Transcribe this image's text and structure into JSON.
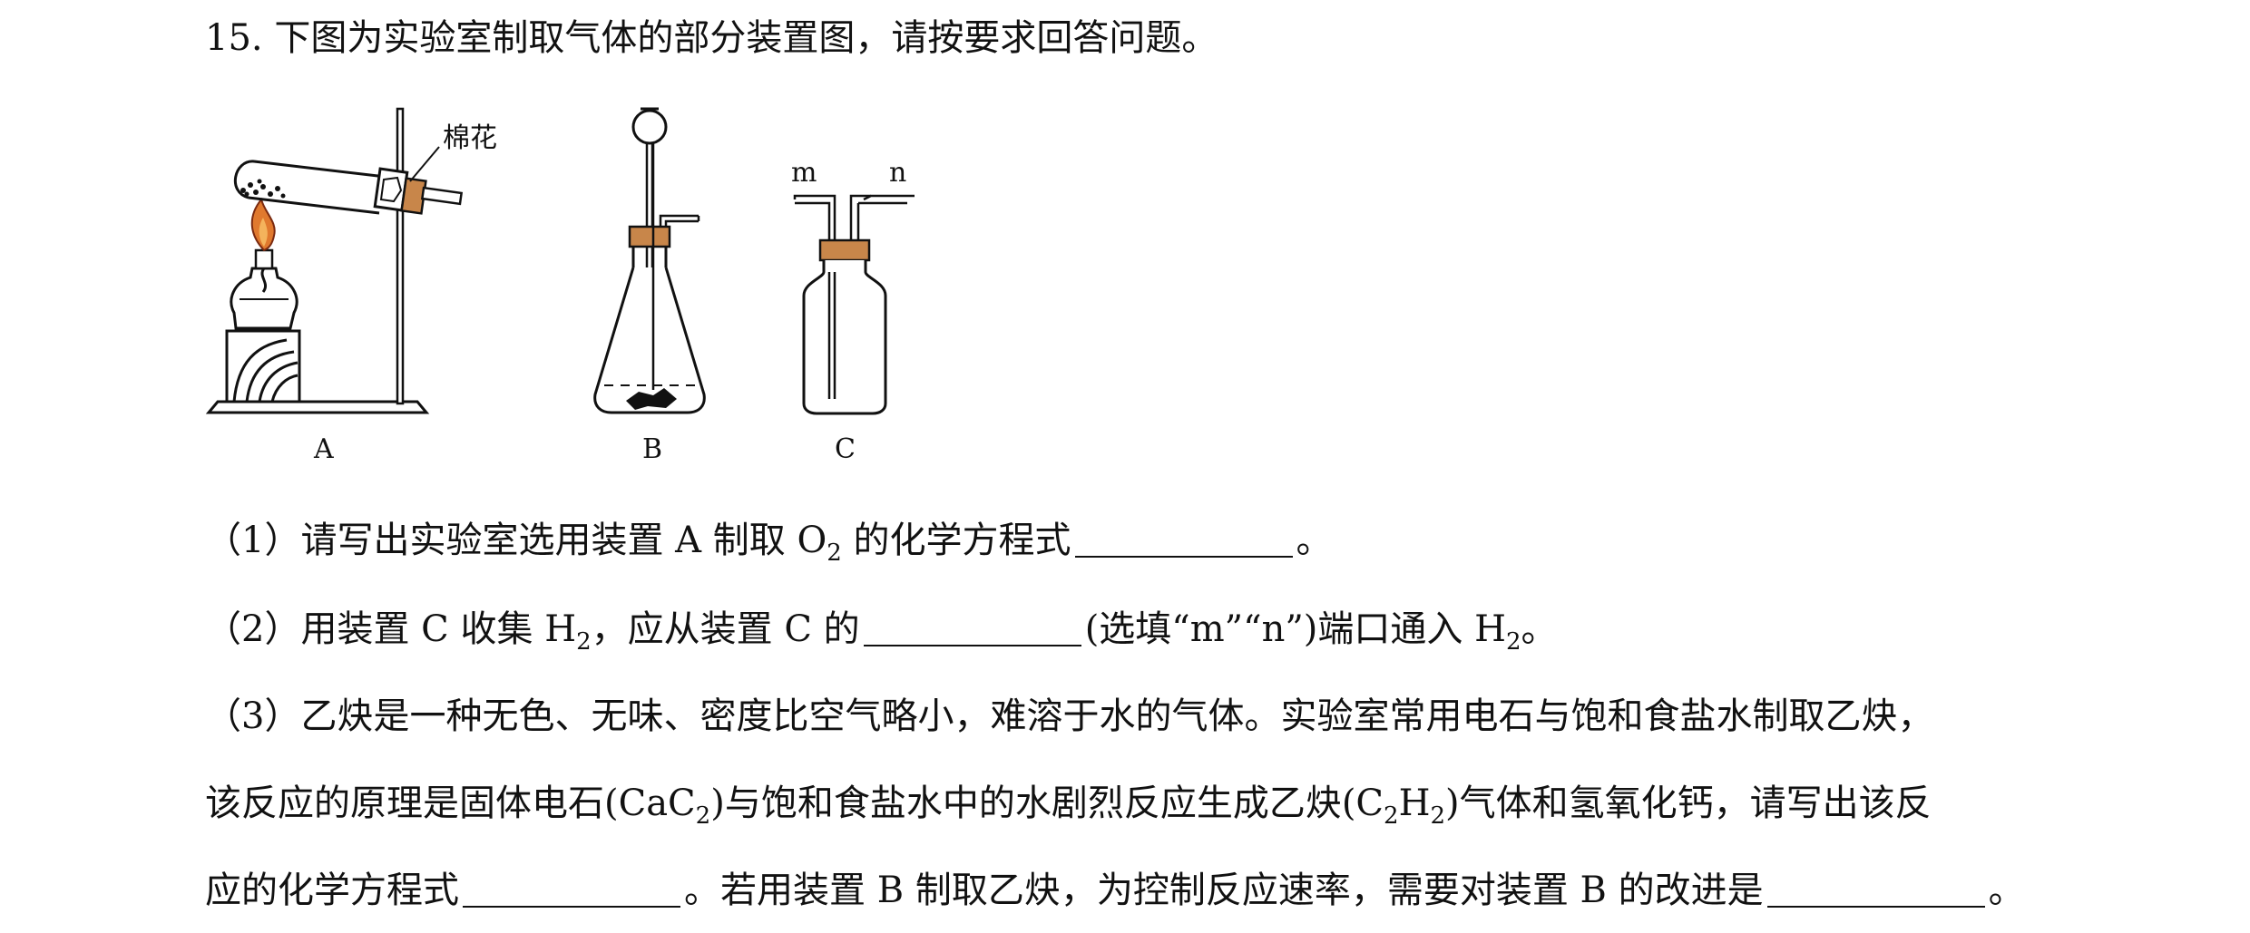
{
  "question": {
    "title": "15. 下图为实验室制取气体的部分装置图，请按要求回答问题。"
  },
  "figure": {
    "cotton_label": "棉花",
    "label_A": "A",
    "label_B": "B",
    "label_C": "C",
    "port_m": "m",
    "port_n": "n"
  },
  "part1": {
    "prefix": "（1）请写出实验室选用装置 A 制取 O",
    "sub": "2",
    "suffix": " 的化学方程式",
    "end": "。"
  },
  "part2": {
    "prefix": "（2）用装置 C 收集 H",
    "sub1": "2",
    "mid": "，应从装置 C 的",
    "after_blank": "(选填“m”“n”)端口通入 H",
    "sub2": "2",
    "end": "。"
  },
  "part3": {
    "line1": "（3）乙炔是一种无色、无味、密度比空气略小，难溶于水的气体。实验室常用电石与饱和食盐水制取乙炔，",
    "line2_a": "该反应的原理是固体电石(CaC",
    "line2_sub1": "2",
    "line2_b": ")与饱和食盐水中的水剧烈反应生成乙炔(C",
    "line2_sub2": "2",
    "line2_c": "H",
    "line2_sub3": "2",
    "line2_d": ")气体和氢氧化钙，请写出该反",
    "line3_a": "应的化学方程式",
    "line3_b": "。若用装置 B 制取乙炔，为控制反应速率，需要对装置 B 的改进是",
    "line3_end": "。"
  }
}
